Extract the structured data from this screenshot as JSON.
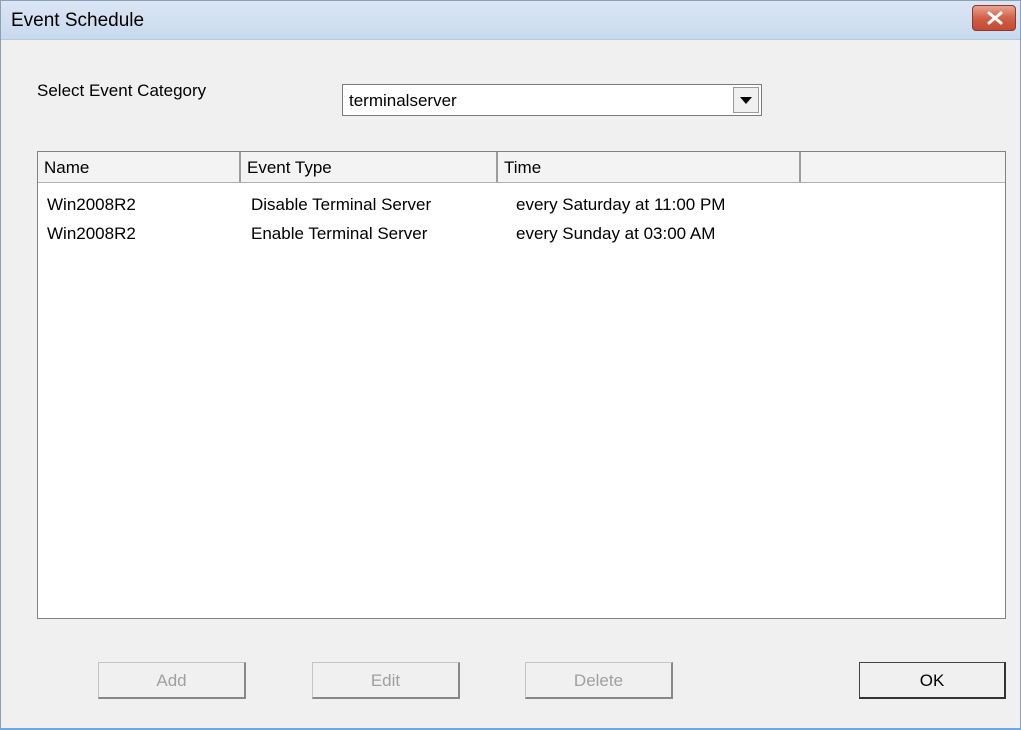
{
  "window": {
    "title": "Event Schedule"
  },
  "category": {
    "label": "Select Event Category",
    "selected": "terminalserver"
  },
  "list": {
    "columns": [
      "Name",
      "Event Type",
      "Time",
      ""
    ],
    "rows": [
      {
        "name": "Win2008R2",
        "event_type": "Disable Terminal Server",
        "time": "every Saturday at 11:00 PM"
      },
      {
        "name": "Win2008R2",
        "event_type": "Enable Terminal Server",
        "time": "every Sunday at 03:00 AM"
      }
    ]
  },
  "buttons": {
    "add": "Add",
    "edit": "Edit",
    "delete": "Delete",
    "ok": "OK"
  },
  "icons": {
    "close": "close-icon",
    "dropdown": "chevron-down-icon"
  }
}
